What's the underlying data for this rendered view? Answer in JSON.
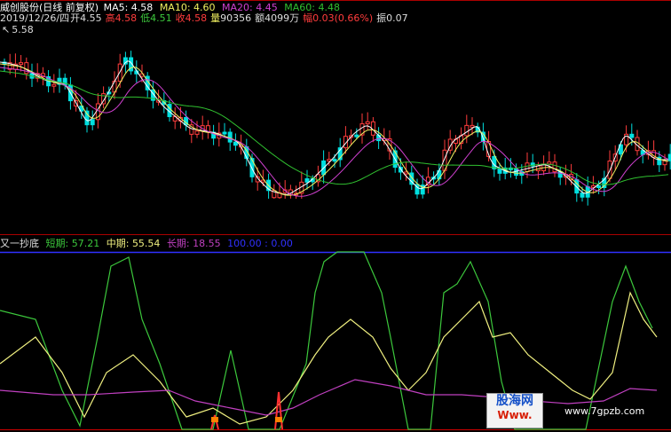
{
  "header": {
    "title": "威创股份(日线 前复权)",
    "ma5": "MA5: 4.58",
    "ma10": "MA10: 4.60",
    "ma20": "MA20: 4.45",
    "ma60": "MA60: 4.48"
  },
  "quote": {
    "date": "2019/12/26/四",
    "open_label": "开",
    "open": "4.55",
    "high_label": "高",
    "high": "4.58",
    "low_label": "低",
    "low": "4.51",
    "close_label": "收",
    "close": "4.58",
    "volume_label": "量",
    "volume": "90356",
    "amount_label": "额",
    "amount": "4099万",
    "change_label": "幅",
    "change": "0.03(0.66%)",
    "amplitude_label": "振0.07"
  },
  "price_high_marker": "5.58",
  "indicator": {
    "name": "又一抄底",
    "short_label": "短期:",
    "short": "57.21",
    "mid_label": "中期:",
    "mid": "55.54",
    "long_label": "长期:",
    "long": "18.55",
    "ref_line": "100.00 : 0.00"
  },
  "watermark": {
    "line1": "股海网",
    "line2": "Www.",
    "site": "www.7gpzb.com"
  },
  "colors": {
    "up": "#ff3c3c",
    "down": "#00e0e0",
    "ma5": "#ffffff",
    "ma10": "#f0f060",
    "ma20": "#d040d0",
    "ma60": "#30c030",
    "short": "#3cc83c",
    "mid": "#f0f080",
    "long": "#c040c0",
    "ref": "#3030ff"
  }
}
